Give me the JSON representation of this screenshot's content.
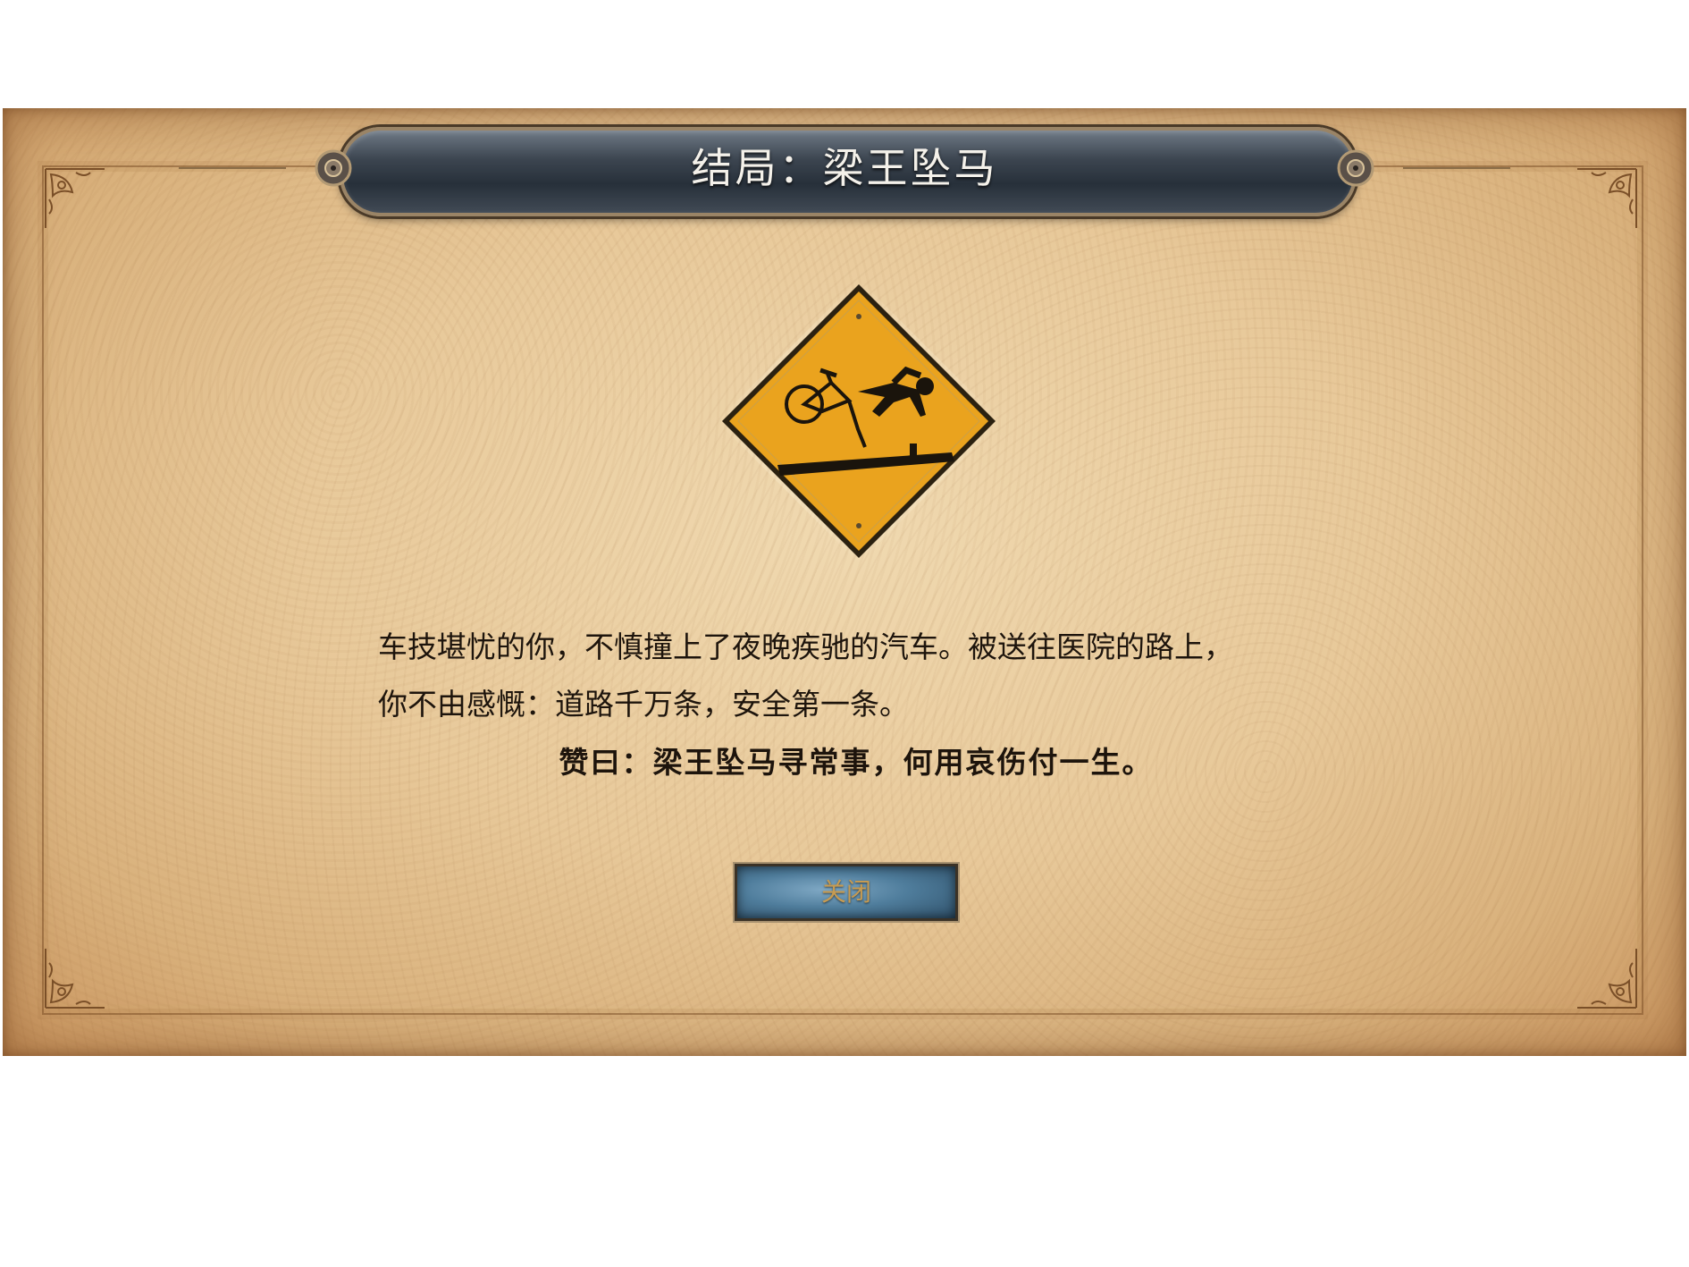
{
  "dialog": {
    "title": "结局：梁王坠马",
    "story_lines": [
      "车技堪忧的你，不慎撞上了夜晚疾驰的汽车。被送往医院的路上，",
      "你不由感慨：道路千万条，安全第一条。"
    ],
    "verse": "赞曰：梁王坠马寻常事，何用哀伤付一生。",
    "close_label": "关闭",
    "sign_icon": "bicycle-crash-warning-icon"
  },
  "colors": {
    "parchment": "#e8c99a",
    "banner": "#2f3843",
    "title_text": "#f4f1ea",
    "sign_yellow": "#eaa31e",
    "button_blue": "#4f7d9c",
    "button_text": "#c69b52"
  }
}
